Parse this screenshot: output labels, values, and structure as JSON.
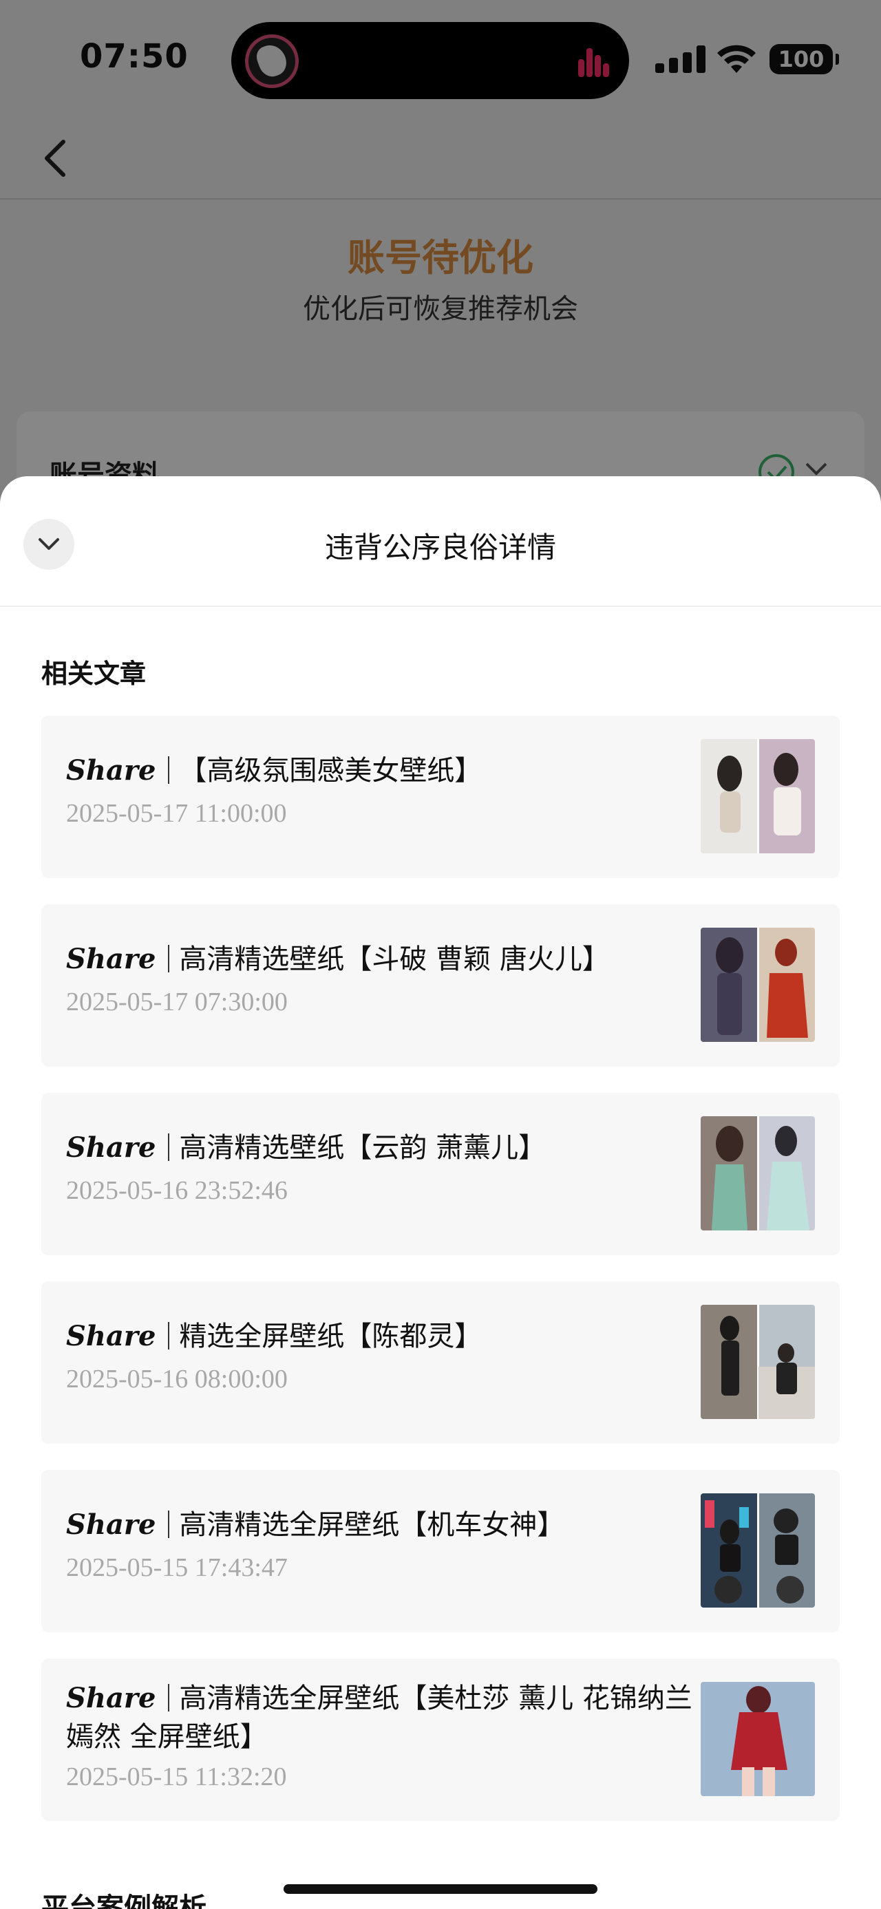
{
  "status_bar": {
    "time": "07:50",
    "battery": "100"
  },
  "background": {
    "title": "账号待优化",
    "subtitle": "优化后可恢复推荐机会",
    "card_label": "账号资料"
  },
  "sheet": {
    "title": "违背公序良俗详情",
    "section_related": "相关文章",
    "section_cases": "平台案例解析"
  },
  "articles": [
    {
      "prefix": "Share",
      "title": "【高级氛围感美女壁纸】",
      "date": "2025-05-17 11:00:00"
    },
    {
      "prefix": "Share",
      "title": "高清精选壁纸【斗破 曹颖 唐火儿】",
      "date": "2025-05-17 07:30:00"
    },
    {
      "prefix": "Share",
      "title": "高清精选壁纸【云韵 萧薰儿】",
      "date": "2025-05-16 23:52:46"
    },
    {
      "prefix": "Share",
      "title": "精选全屏壁纸【陈都灵】",
      "date": "2025-05-16 08:00:00"
    },
    {
      "prefix": "Share",
      "title": "高清精选全屏壁纸【机车女神】",
      "date": "2025-05-15 17:43:47"
    },
    {
      "prefix": "Share",
      "title": "高清精选全屏壁纸【美杜莎 薰儿 花锦纳兰嫣然 全屏壁纸】",
      "date": "2025-05-15 11:32:20"
    }
  ],
  "colors": {
    "accent_orange": "#d98c3f",
    "card_bg": "#f7f7f7",
    "date_gray": "#a8a8a8",
    "island_bars": "#ff2f6a"
  },
  "icons": {
    "back": "chevron-left-icon",
    "collapse": "chevron-down-icon",
    "signal": "signal-icon",
    "wifi": "wifi-icon",
    "battery": "battery-icon"
  }
}
